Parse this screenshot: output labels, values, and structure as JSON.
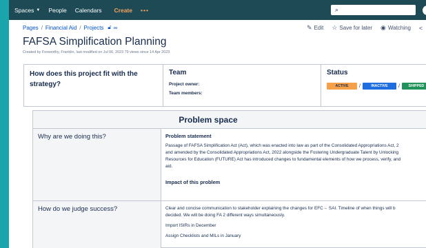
{
  "nav": {
    "spaces": "Spaces",
    "people": "People",
    "calendars": "Calendars",
    "create": "Create",
    "more": "•••",
    "search_placeholder": ""
  },
  "breadcrumb": {
    "items": [
      "Pages",
      "Financial Aid",
      "Projects"
    ]
  },
  "actions": {
    "edit": "Edit",
    "save": "Save for later",
    "watching": "Watching"
  },
  "page": {
    "title": "FAFSA Simplification Planning",
    "byline": "Created by Foxworthy, Franklin, last modified on Jul 06, 2023   79 views since 14 Apr 2023"
  },
  "info": {
    "strategy_heading": "How does this project fit with the strategy?",
    "team_heading": "Team",
    "project_owner": "Project owner:",
    "team_members": "Team members:",
    "status_heading": "Status",
    "status": [
      "ACTIVE",
      "INACTIVE",
      "SHIPPED"
    ]
  },
  "problem": {
    "header": "Problem space",
    "row1_label": "Why are we doing this?",
    "statement_heading": "Problem statement",
    "statement_l1": "Passage of FAFSA Simplification Act (Act), which was enacted into law as part of the Consolidated Appropriations Act, 2",
    "statement_l2": "and amended by the Consolidated Appropriations Act, 2022 alongside the Fostering Undergraduate Talent by Unlocking",
    "statement_l3": "Resources for Education (FUTURE) Act has introduced changes to fundamental elements of how we process, verify, and",
    "statement_l4": "aid.",
    "impact_heading": "Impact of this problem",
    "row2_label": "How do we judge success?",
    "success_l1": "Clear and concise communication to stakeholder explaining the changes for EFC→ SAI. Timeline of when things will b",
    "success_l2": "decided. We will be doing FA 2 different ways simultaneously.",
    "success_l3": "Import ISIRs in December",
    "success_l4": "Assign Checklists and MILs in January"
  }
}
